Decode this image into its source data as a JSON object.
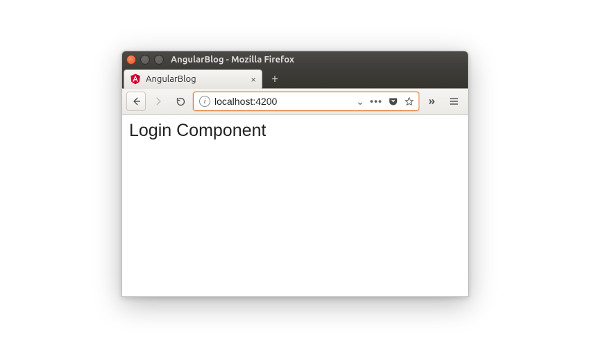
{
  "titlebar": {
    "title": "AngularBlog - Mozilla Firefox"
  },
  "tabs": {
    "active": {
      "title": "AngularBlog"
    }
  },
  "toolbar": {
    "info_glyph": "i",
    "dropdown_glyph": "⌄",
    "dots": "•••",
    "overflow_glyph": "»"
  },
  "urlbar": {
    "value": "localhost:4200"
  },
  "page": {
    "heading": "Login Component"
  }
}
